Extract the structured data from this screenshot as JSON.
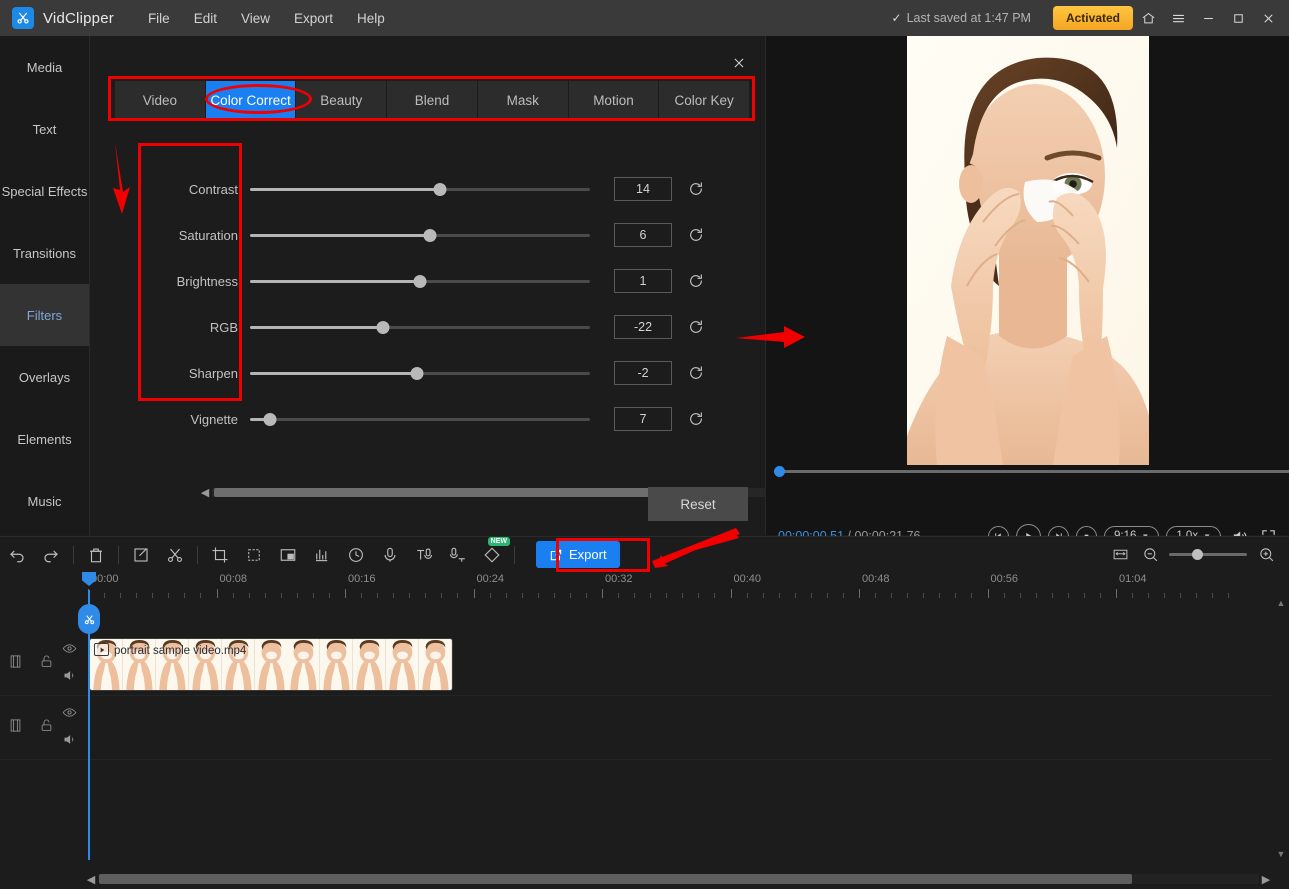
{
  "titlebar": {
    "app_name": "VidClipper",
    "menus": [
      "File",
      "Edit",
      "View",
      "Export",
      "Help"
    ],
    "saved_text": "Last saved at 1:47 PM",
    "activated_label": "Activated",
    "window_buttons": [
      "home-icon",
      "hamburger-menu-icon",
      "minimize-icon",
      "maximize-icon",
      "close-icon"
    ]
  },
  "sidebar": {
    "items": [
      {
        "label": "Media",
        "active": false
      },
      {
        "label": "Text",
        "active": false
      },
      {
        "label": "Special Effects",
        "active": false
      },
      {
        "label": "Transitions",
        "active": false
      },
      {
        "label": "Filters",
        "active": true
      },
      {
        "label": "Overlays",
        "active": false
      },
      {
        "label": "Elements",
        "active": false
      },
      {
        "label": "Music",
        "active": false
      }
    ]
  },
  "panel": {
    "tabs": [
      {
        "label": "Video",
        "active": false
      },
      {
        "label": "Color Correct",
        "active": true
      },
      {
        "label": "Beauty",
        "active": false
      },
      {
        "label": "Blend",
        "active": false
      },
      {
        "label": "Mask",
        "active": false
      },
      {
        "label": "Motion",
        "active": false
      },
      {
        "label": "Color Key",
        "active": false
      }
    ],
    "sliders": [
      {
        "label": "Contrast",
        "value": "14",
        "pct": 56
      },
      {
        "label": "Saturation",
        "value": "6",
        "pct": 53
      },
      {
        "label": "Brightness",
        "value": "1",
        "pct": 50
      },
      {
        "label": "RGB",
        "value": "-22",
        "pct": 39
      },
      {
        "label": "Sharpen",
        "value": "-2",
        "pct": 49
      },
      {
        "label": "Vignette",
        "value": "7",
        "pct": 6
      }
    ],
    "reset_label": "Reset",
    "close_icon": "close-icon"
  },
  "preview": {
    "current_time": "00:00:00.51",
    "separator": " / ",
    "total_time": "00:00:21.76",
    "aspect_ratio": "9:16",
    "playback_speed": "1.0x",
    "controls": [
      "step-back-icon",
      "play-icon",
      "step-forward-icon",
      "stop-icon"
    ],
    "volume_icon": "volume-icon",
    "fullscreen_icon": "fullscreen-icon"
  },
  "toolbar": {
    "tools": [
      "undo-icon",
      "redo-icon",
      "delete-icon",
      "edit-icon",
      "cut-icon",
      "crop-icon",
      "duplicate-icon",
      "picture-in-picture-icon",
      "audio-wave-icon",
      "duration-clock-icon",
      "microphone-icon",
      "text-to-speech-icon",
      "speech-to-text-icon",
      "ai-diamond-icon"
    ],
    "new_badge": "NEW",
    "export_label": "Export",
    "zoom_controls": [
      "fit-timeline-icon",
      "zoom-out-icon",
      "zoom-slider",
      "zoom-in-icon"
    ]
  },
  "timeline": {
    "ruler_labels": [
      "00:00",
      "00:08",
      "00:16",
      "00:24",
      "00:32",
      "00:40",
      "00:48",
      "00:56",
      "01:04"
    ],
    "tracks": [
      {
        "icons": [
          "film-strip-icon",
          "unlock-icon",
          "eye-icon",
          "speaker-icon"
        ],
        "clip": "portrait sample video.mp4"
      },
      {
        "icons": [
          "film-strip-icon",
          "unlock-icon",
          "eye-icon",
          "speaker-icon"
        ],
        "clip": null
      }
    ]
  },
  "colors": {
    "accent_blue": "#1a7ff0",
    "annotation_red": "#f00000",
    "activated_yellow": "#f5a623",
    "playhead_blue": "#2f8ae8"
  }
}
